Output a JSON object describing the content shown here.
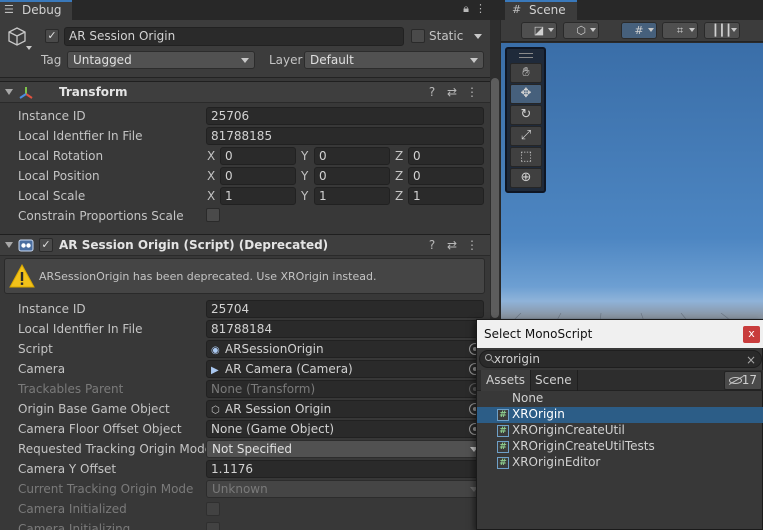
{
  "inspector": {
    "tab": "Debug",
    "object_name": "AR Session Origin",
    "static_label": "Static",
    "tag_label": "Tag",
    "tag_value": "Untagged",
    "layer_label": "Layer",
    "layer_value": "Default"
  },
  "transform": {
    "title": "Transform",
    "rows": [
      {
        "label": "Instance ID",
        "value": "25706"
      },
      {
        "label": "Local Identfier In File",
        "value": "81788185"
      }
    ],
    "rotation": {
      "label": "Local Rotation",
      "x": "0",
      "y": "0",
      "z": "0"
    },
    "position": {
      "label": "Local Position",
      "x": "0",
      "y": "0",
      "z": "0"
    },
    "scale": {
      "label": "Local Scale",
      "x": "1",
      "y": "1",
      "z": "1"
    },
    "constrain_label": "Constrain Proportions Scale",
    "axis_x": "X",
    "axis_y": "Y",
    "axis_z": "Z"
  },
  "ar_component": {
    "title": "AR Session Origin (Script) (Deprecated)",
    "warning": "ARSessionOrigin has been deprecated. Use XROrigin instead.",
    "instance_label": "Instance ID",
    "instance_value": "25704",
    "file_label": "Local Identfier In File",
    "file_value": "81788184",
    "script_label": "Script",
    "script_value": "ARSessionOrigin",
    "camera_label": "Camera",
    "camera_value": "AR Camera (Camera)",
    "trackables_label": "Trackables Parent",
    "trackables_value": "None (Transform)",
    "origin_label": "Origin Base Game Object",
    "origin_value": "AR Session Origin",
    "floor_label": "Camera Floor Offset Object",
    "floor_value": "None (Game Object)",
    "tracking_mode_label": "Requested Tracking Origin Mode",
    "tracking_mode_value": "Not Specified",
    "y_offset_label": "Camera Y Offset",
    "y_offset_value": "1.1176",
    "current_mode_label": "Current Tracking Origin Mode",
    "current_mode_value": "Unknown",
    "cam_init_label": "Camera Initialized",
    "cam_init2_label": "Camera Initializing"
  },
  "scene": {
    "tab": "Scene"
  },
  "popup": {
    "title": "Select MonoScript",
    "close": "x",
    "search_value": "xrorigin",
    "clear": "×",
    "tab_assets": "Assets",
    "tab_scene": "Scene",
    "hidden_count": "17",
    "items": [
      "None",
      "XROrigin",
      "XROriginCreateUtil",
      "XROriginCreateUtilTests",
      "XROriginEditor"
    ],
    "selected_index": 1
  },
  "colors": {
    "accent_blue": "#3a79bb",
    "selection": "#2c5d87",
    "warning_yellow": "#f2c21a",
    "close_red": "#c83c3c"
  }
}
